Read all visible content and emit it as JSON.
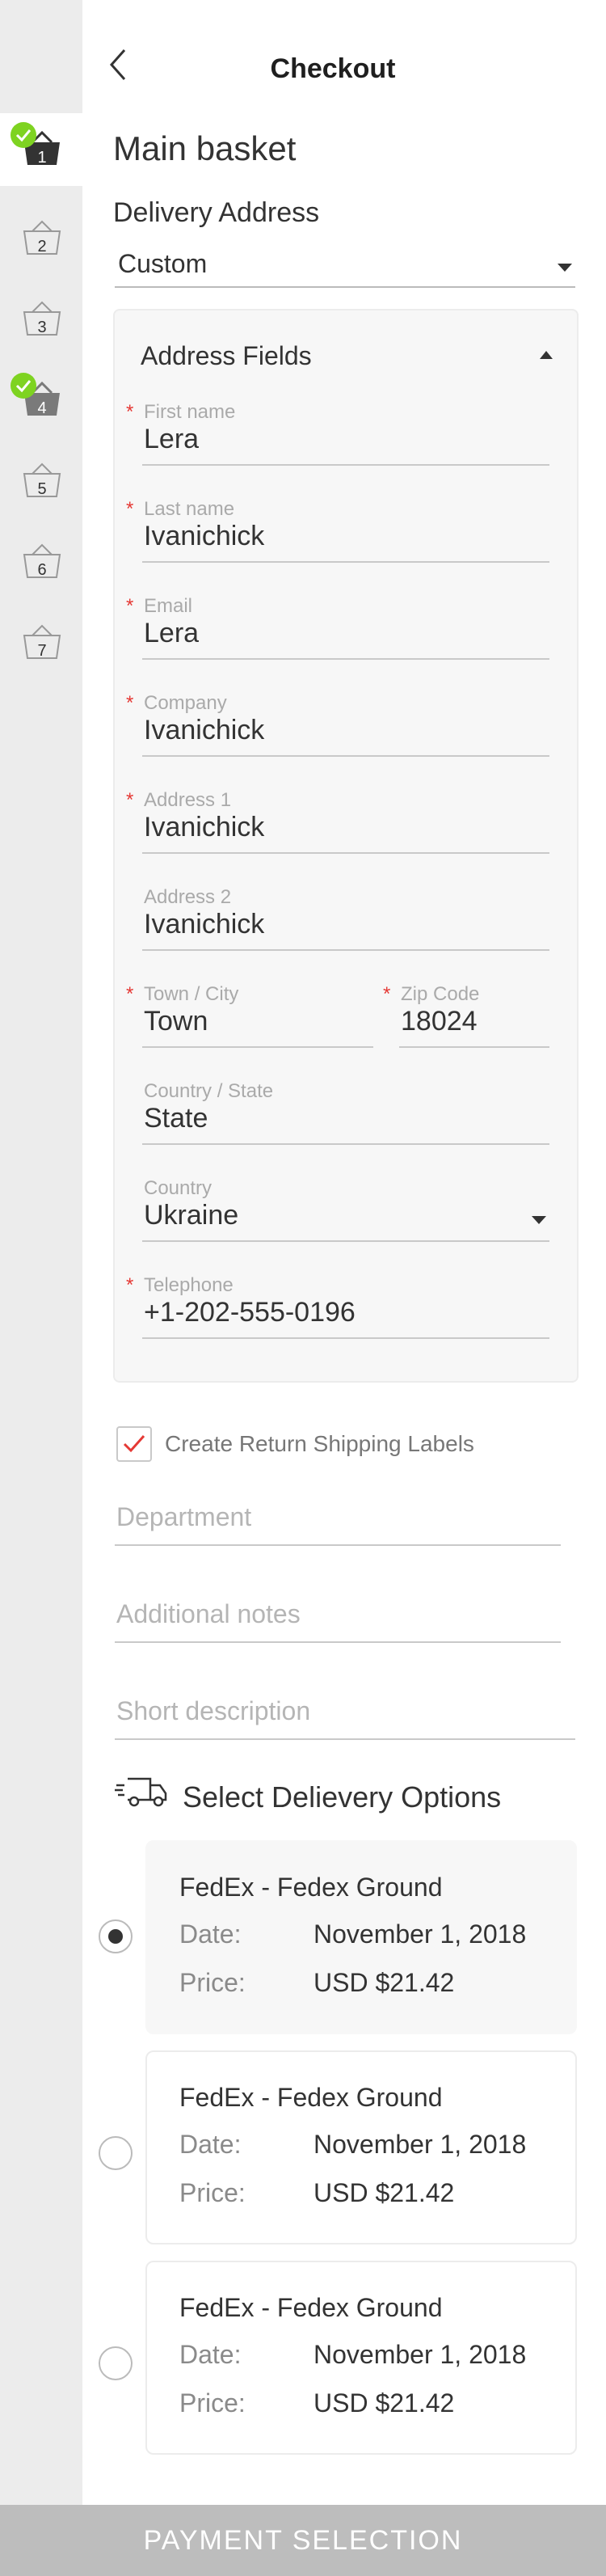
{
  "header": {
    "title": "Checkout"
  },
  "sidebar": {
    "baskets": [
      {
        "number": "1",
        "completed": true,
        "active": true
      },
      {
        "number": "2",
        "completed": false,
        "active": false
      },
      {
        "number": "3",
        "completed": false,
        "active": false
      },
      {
        "number": "4",
        "completed": true,
        "active": false
      },
      {
        "number": "5",
        "completed": false,
        "active": false
      },
      {
        "number": "6",
        "completed": false,
        "active": false
      },
      {
        "number": "7",
        "completed": false,
        "active": false
      }
    ]
  },
  "basket_title": "Main basket",
  "delivery": {
    "label": "Delivery Address",
    "address_type": "Custom"
  },
  "address_fields": {
    "heading": "Address Fields",
    "first_name": {
      "label": "First name",
      "value": "Lera"
    },
    "last_name": {
      "label": "Last name",
      "value": "Ivanichick"
    },
    "email": {
      "label": "Email",
      "value": "Lera"
    },
    "company": {
      "label": "Company",
      "value": "Ivanichick"
    },
    "address1": {
      "label": "Address 1",
      "value": "Ivanichick"
    },
    "address2": {
      "label": "Address 2",
      "value": "Ivanichick"
    },
    "town": {
      "label": "Town / City",
      "value": "Town"
    },
    "zip": {
      "label": "Zip Code",
      "value": "18024"
    },
    "state": {
      "label": "Country / State",
      "value": "State"
    },
    "country": {
      "label": "Country",
      "value": "Ukraine"
    },
    "telephone": {
      "label": "Telephone",
      "value": "+1-202-555-0196"
    },
    "required_mark": "*"
  },
  "return_labels": {
    "label": "Create Return Shipping Labels",
    "checked": true
  },
  "inputs": {
    "department_placeholder": "Department",
    "notes_placeholder": "Additional notes",
    "description_placeholder": "Short description"
  },
  "delivery_options": {
    "heading": "Select Delievery Options",
    "date_label": "Date:",
    "price_label": "Price:",
    "options": [
      {
        "carrier": "FedEx - Fedex Ground",
        "date": "November 1, 2018",
        "price": "USD $21.42",
        "selected": true
      },
      {
        "carrier": "FedEx - Fedex Ground",
        "date": "November 1, 2018",
        "price": "USD $21.42",
        "selected": false
      },
      {
        "carrier": "FedEx - Fedex Ground",
        "date": "November 1, 2018",
        "price": "USD $21.42",
        "selected": false
      }
    ]
  },
  "footer": {
    "button_label": "PAYMENT SELECTION"
  },
  "colors": {
    "check_green": "#7ed321",
    "required_red": "#e53935",
    "checkmark_red": "#e53935",
    "footer_bg": "#bdbdbd"
  }
}
